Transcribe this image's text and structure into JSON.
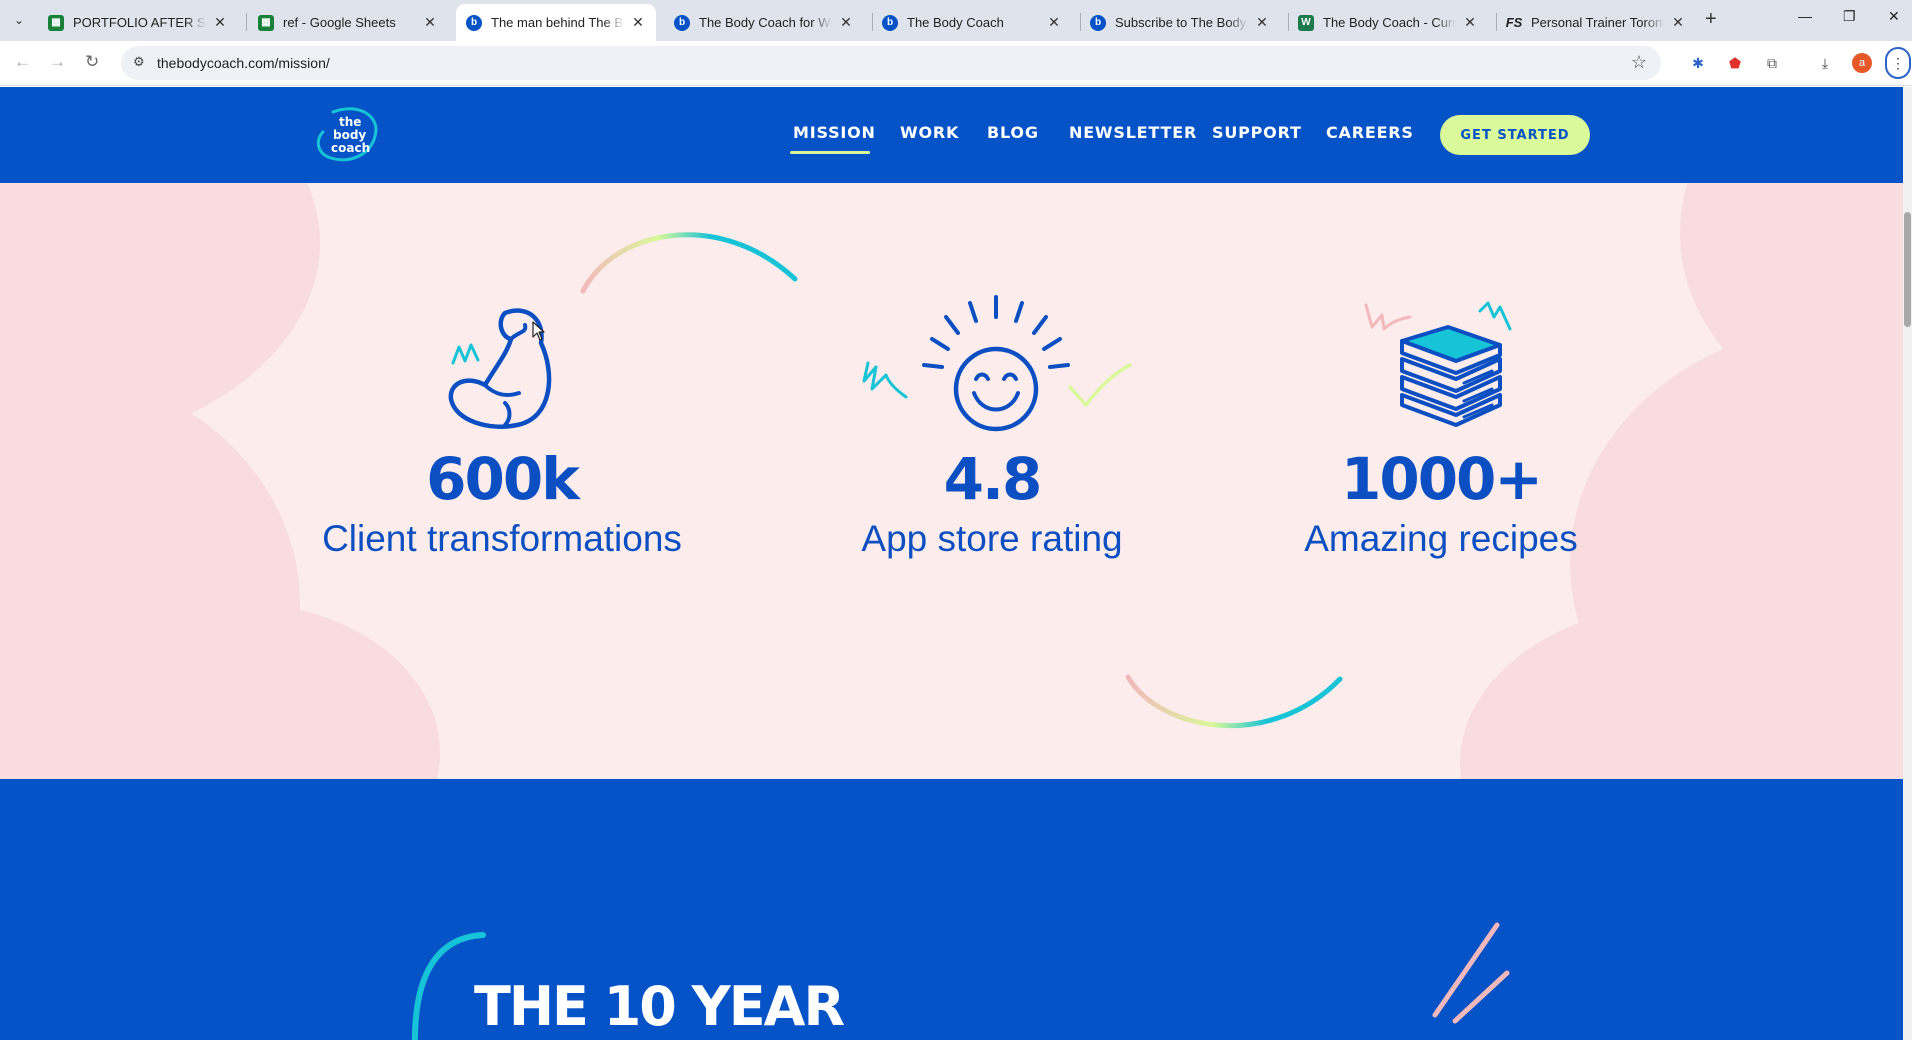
{
  "browser": {
    "tabs": [
      {
        "title": "PORTFOLIO AFTER SELLIN",
        "favicon": "sheets-icon",
        "active": false
      },
      {
        "title": "ref - Google Sheets",
        "favicon": "sheets-icon",
        "active": false
      },
      {
        "title": "The man behind The Body",
        "favicon": "bodycoach-icon",
        "active": true
      },
      {
        "title": "The Body Coach for Work",
        "favicon": "bodycoach-icon",
        "active": false
      },
      {
        "title": "The Body Coach",
        "favicon": "bodycoach-icon",
        "active": false
      },
      {
        "title": "Subscribe to The Body Co",
        "favicon": "bodycoach-icon",
        "active": false
      },
      {
        "title": "The Body Coach - Curren",
        "favicon": "bodycoach-green-icon",
        "active": false
      },
      {
        "title": "Personal Trainer Toronto -",
        "favicon": "fs-icon",
        "active": false
      }
    ],
    "new_tab": "+",
    "url": "thebodycoach.com/mission/",
    "profile_initial": "a"
  },
  "site": {
    "logo_lines": [
      "the",
      "body",
      "coach"
    ],
    "nav": [
      "MISSION",
      "WORK",
      "BLOG",
      "NEWSLETTER",
      "SUPPORT",
      "CAREERS"
    ],
    "active_nav": "MISSION",
    "cta": "GET STARTED"
  },
  "stats": [
    {
      "number": "600k",
      "label": "Client transformations",
      "icon": "flexed-arm-icon"
    },
    {
      "number": "4.8",
      "label": "App store rating",
      "icon": "smiley-sun-icon"
    },
    {
      "number": "1000+",
      "label": "Amazing recipes",
      "icon": "book-stack-icon"
    }
  ],
  "next_section": {
    "heading": "THE 10 YEAR"
  },
  "colors": {
    "brand_blue": "#0653c8",
    "lime": "#d9f99a",
    "pink_bg": "#fcecec",
    "teal": "#17c3d6",
    "soft_pink": "#f2b8bc"
  }
}
